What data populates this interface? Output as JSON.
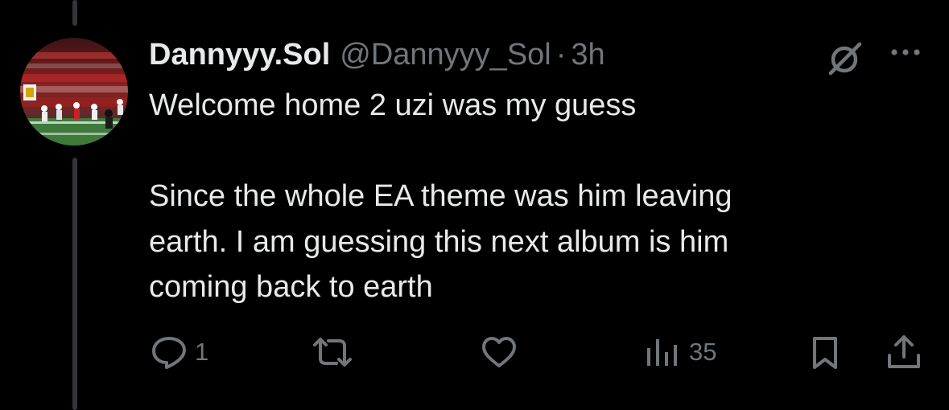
{
  "tweet": {
    "author": {
      "display_name": "Dannyyy.Sol",
      "handle": "@Dannyyy_Sol",
      "separator": "·",
      "time": "3h",
      "avatar_icon": "football-stadium-avatar"
    },
    "text_lines": [
      "Welcome home 2 uzi was my guess",
      "",
      "Since the whole EA theme was him leaving",
      "earth. I am guessing this next album is him",
      "coming back to earth"
    ],
    "icons": {
      "grok": "grok-icon",
      "more": "more-icon"
    },
    "actions": {
      "reply_count": "1",
      "retweet_count": "",
      "like_count": "",
      "views_count": "35"
    }
  },
  "colors": {
    "background": "#000000",
    "text_primary": "#e7e9ea",
    "text_secondary": "#71767b",
    "thread_line": "#333639"
  }
}
